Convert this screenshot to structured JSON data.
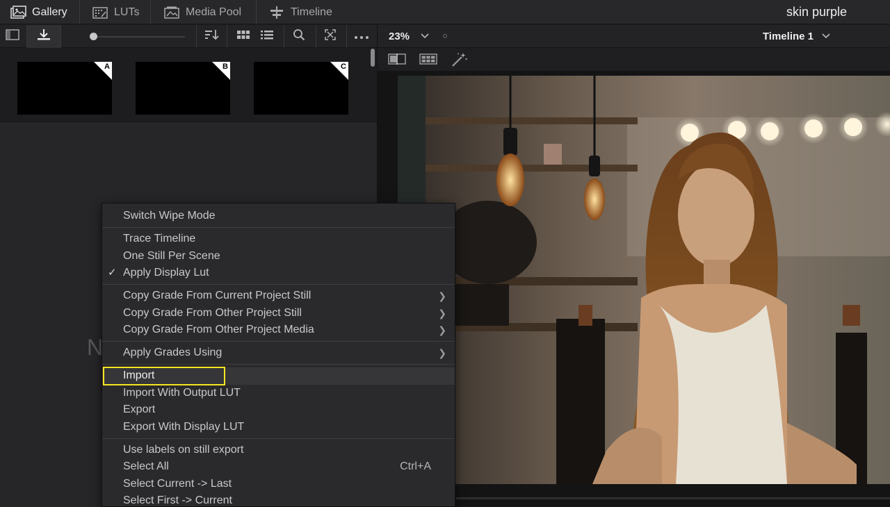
{
  "topbar": {
    "tabs": [
      {
        "label": "Gallery",
        "icon": "gallery-icon",
        "active": true
      },
      {
        "label": "LUTs",
        "icon": "luts-icon",
        "active": false
      },
      {
        "label": "Media Pool",
        "icon": "media-pool-icon",
        "active": false
      },
      {
        "label": "Timeline",
        "icon": "timeline-icon",
        "active": false
      }
    ],
    "project_title": "skin purple"
  },
  "gallery_toolbar": {
    "icons": [
      "sidebar-toggle-icon",
      "grab-still-icon",
      "zoom-slider",
      "sort-icon",
      "grid-view-icon",
      "list-view-icon",
      "search-icon",
      "fit-icon",
      "more-options-icon"
    ]
  },
  "viewer_toolbar": {
    "zoom": "23%",
    "timeline_name": "Timeline 1"
  },
  "viewer_tools": {
    "icons": [
      "wipe-icon",
      "split-screen-icon",
      "highlight-icon"
    ]
  },
  "stills": [
    {
      "label": "A"
    },
    {
      "label": "B"
    },
    {
      "label": "C"
    }
  ],
  "gallery_placeholder_text": "N",
  "context_menu": {
    "groups": [
      [
        {
          "label": "Switch Wipe Mode"
        }
      ],
      [
        {
          "label": "Trace Timeline"
        },
        {
          "label": "One Still Per Scene"
        },
        {
          "label": "Apply Display Lut",
          "checked": true
        }
      ],
      [
        {
          "label": "Copy Grade From Current Project Still",
          "submenu": true
        },
        {
          "label": "Copy Grade From Other Project Still",
          "submenu": true
        },
        {
          "label": "Copy Grade From Other Project Media",
          "submenu": true
        }
      ],
      [
        {
          "label": "Apply Grades Using",
          "submenu": true
        }
      ],
      [
        {
          "label": "Import",
          "highlighted": true
        },
        {
          "label": "Import With Output LUT"
        },
        {
          "label": "Export"
        },
        {
          "label": "Export With Display LUT"
        }
      ],
      [
        {
          "label": "Use labels on still export"
        },
        {
          "label": "Select All",
          "shortcut": "Ctrl+A"
        },
        {
          "label": "Select Current -> Last"
        },
        {
          "label": "Select First -> Current"
        }
      ]
    ],
    "check_glyph": "✓",
    "submenu_glyph": "❯"
  },
  "colors": {
    "highlight_box": "#f5e61e",
    "menu_bg": "#2a2a2c",
    "panel_bg": "#262628"
  }
}
